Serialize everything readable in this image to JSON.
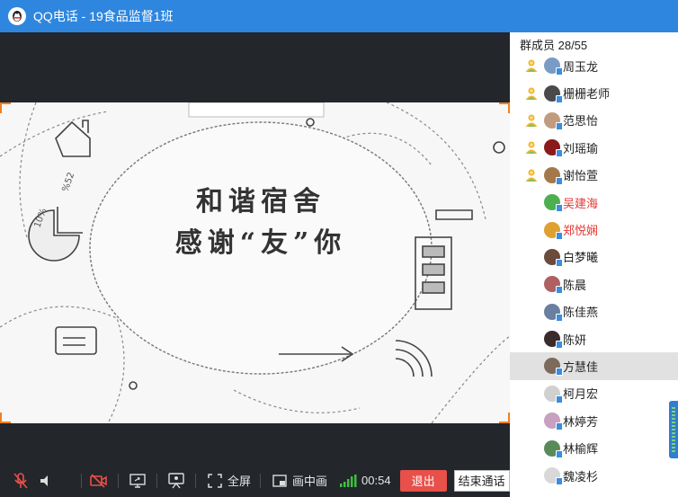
{
  "window": {
    "app_name": "QQ电话",
    "separator": " - ",
    "group_name": "19食品监督1班"
  },
  "slide": {
    "line1": "和谐宿舍",
    "line2": "感谢“友”你"
  },
  "toolbar": {
    "fullscreen_label": "全屏",
    "pip_label": "画中画",
    "timer": "00:54",
    "exit_label": "退出",
    "end_call_label": "结束通话",
    "icons": [
      "mic-muted-icon",
      "speaker-icon",
      "camera-off-icon",
      "screen-share-icon",
      "presentation-icon",
      "fullscreen-icon",
      "pip-icon",
      "signal-icon"
    ]
  },
  "members_panel": {
    "header": "群成员 28/55",
    "members": [
      {
        "name": "周玉龙",
        "role": true,
        "avatar_color": "#7a9bc4",
        "red": false
      },
      {
        "name": "栅栅老师",
        "role": true,
        "avatar_color": "#4a4a4a",
        "red": false
      },
      {
        "name": "范思怡",
        "role": true,
        "avatar_color": "#c29b7f",
        "red": false
      },
      {
        "name": "刘瑶瑜",
        "role": true,
        "avatar_color": "#8b1a1a",
        "red": false
      },
      {
        "name": "谢怡萱",
        "role": true,
        "avatar_color": "#a5784a",
        "red": false
      },
      {
        "name": "吴建海",
        "role": false,
        "avatar_color": "#4caf50",
        "red": true
      },
      {
        "name": "郑悦娴",
        "role": false,
        "avatar_color": "#e0a030",
        "red": true
      },
      {
        "name": "白梦曦",
        "role": false,
        "avatar_color": "#6b4b3b",
        "red": false
      },
      {
        "name": "陈晨",
        "role": false,
        "avatar_color": "#b06060",
        "red": false
      },
      {
        "name": "陈佳燕",
        "role": false,
        "avatar_color": "#6a7fa0",
        "red": false
      },
      {
        "name": "陈妍",
        "role": false,
        "avatar_color": "#3b2b2b",
        "red": false
      },
      {
        "name": "方慧佳",
        "role": false,
        "avatar_color": "#7d6a5a",
        "red": false
      },
      {
        "name": "柯月宏",
        "role": false,
        "avatar_color": "#d0d0d0",
        "red": false
      },
      {
        "name": "林婷芳",
        "role": false,
        "avatar_color": "#c8a0c0",
        "red": false
      },
      {
        "name": "林榆辉",
        "role": false,
        "avatar_color": "#5a8a5a",
        "red": false
      },
      {
        "name": "魏凌杉",
        "role": false,
        "avatar_color": "#d8d8d8",
        "red": false
      }
    ],
    "selected_index": 11
  }
}
